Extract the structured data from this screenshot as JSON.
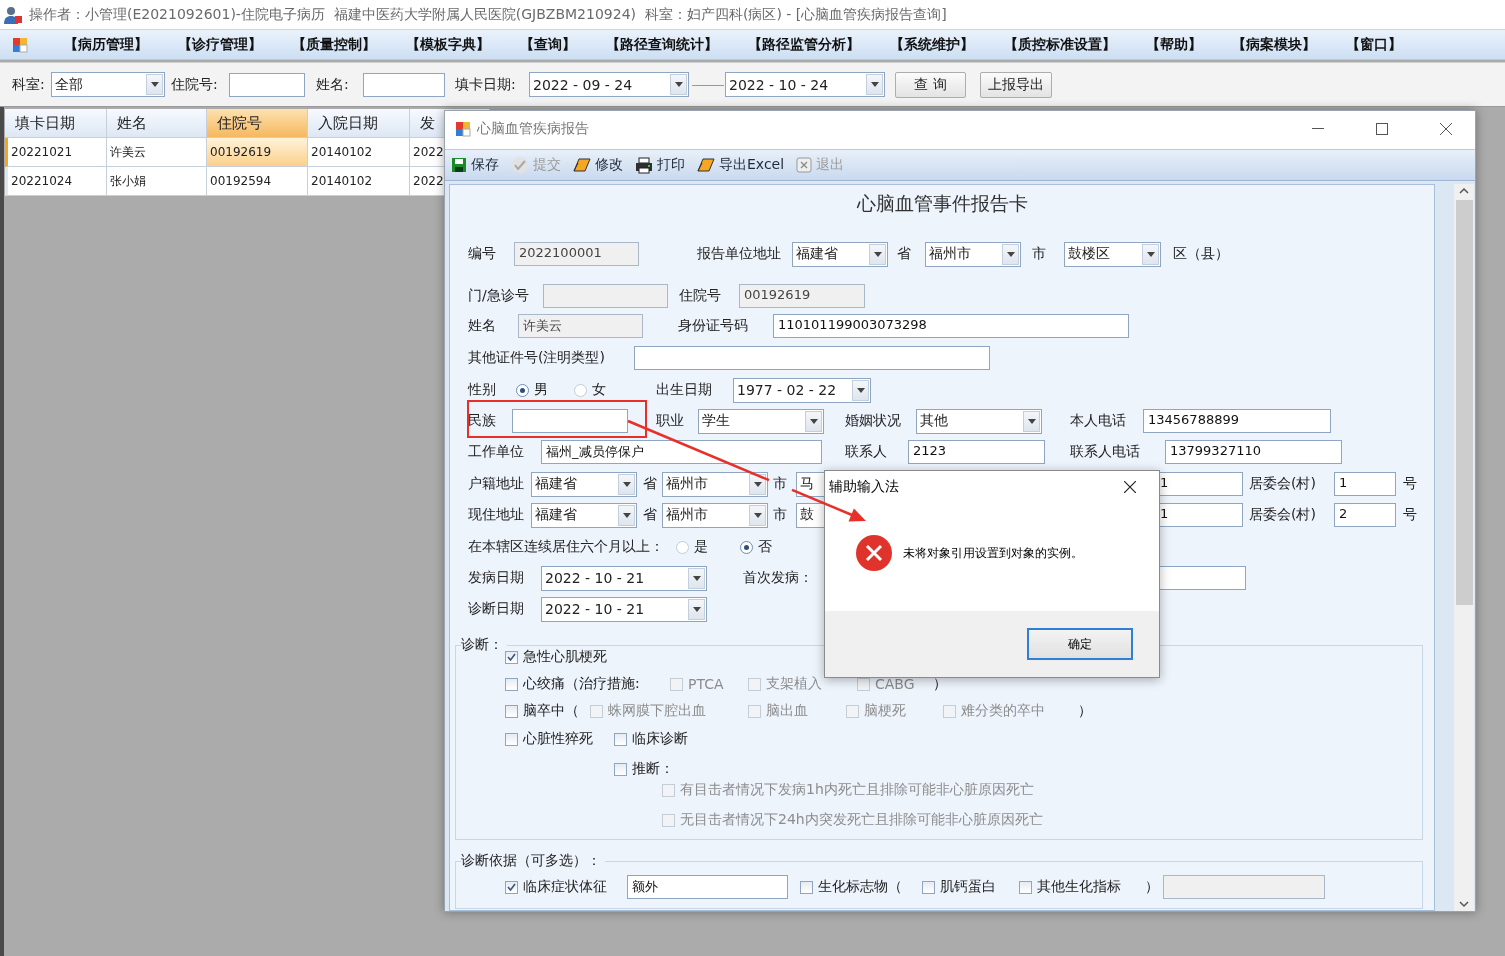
{
  "title_bar": {
    "text": "操作者：小管理(E2021092601)-住院电子病历  福建中医药大学附属人民医院(GJBZBM210924)  科室：妇产四科(病区) - [心脑血管疾病报告查询]"
  },
  "menu": [
    "【病历管理】",
    "【诊疗管理】",
    "【质量控制】",
    "【模板字典】",
    "【查询】",
    "【路径查询统计】",
    "【路径监管分析】",
    "【系统维护】",
    "【质控标准设置】",
    "【帮助】",
    "【病案模块】",
    "【窗口】"
  ],
  "filter": [
    {
      "kind": "label",
      "text": "科室:"
    },
    {
      "kind": "combo",
      "value": "全部"
    },
    {
      "kind": "label",
      "text": "住院号:"
    },
    {
      "kind": "field",
      "readonly": false
    },
    {
      "kind": "label",
      "text": "姓名:"
    },
    {
      "kind": "field",
      "readonly": false
    },
    {
      "kind": "label",
      "text": "填卡日期:"
    },
    {
      "kind": "date",
      "value": "2022 - 09 - 24"
    },
    {
      "kind": "date",
      "value": "2022 - 10 - 24"
    },
    {
      "kind": "button",
      "text": "查 询"
    },
    {
      "kind": "button",
      "text": "上报导出"
    }
  ],
  "table": {
    "columns": [
      {
        "label": "填卡日期",
        "selected": false
      },
      {
        "label": "姓名",
        "selected": false
      },
      {
        "label": "住院号",
        "selected": true
      },
      {
        "label": "入院日期",
        "selected": false
      },
      {
        "label": "发",
        "selected": false
      }
    ],
    "rows": [
      {
        "selected": true,
        "cells": [
          "20221021",
          "许美云",
          "00192619",
          "20140102",
          "2022"
        ]
      },
      {
        "selected": false,
        "cells": [
          "20221024",
          "张小娟",
          "00192594",
          "20140102",
          "2022"
        ]
      }
    ]
  },
  "report_window": {
    "title": "心脑血管疾病报告",
    "toolbar": [
      {
        "label": "保存",
        "disabled": false
      },
      {
        "label": "提交",
        "disabled": true
      },
      {
        "label": "修改",
        "disabled": false
      },
      {
        "label": "打印",
        "disabled": false
      },
      {
        "label": "导出Excel",
        "disabled": false
      },
      {
        "label": "退出",
        "disabled": true
      }
    ],
    "heading": "心脑血管事件报告卡",
    "form": [
      {
        "items": [
          {
            "kind": "label",
            "text": "编号"
          },
          {
            "kind": "field",
            "value": "2022100001",
            "readonly": true
          },
          {
            "kind": "label",
            "text": "报告单位地址"
          },
          {
            "kind": "combo",
            "value": "福建省"
          },
          {
            "kind": "label",
            "text": "省"
          },
          {
            "kind": "combo",
            "value": "福州市"
          },
          {
            "kind": "label",
            "text": "市"
          },
          {
            "kind": "combo",
            "value": "鼓楼区"
          },
          {
            "kind": "label",
            "text": "区（县）"
          }
        ]
      },
      {
        "items": [
          {
            "kind": "label",
            "text": "门/急诊号"
          },
          {
            "kind": "field",
            "readonly": true
          },
          {
            "kind": "label",
            "text": "住院号"
          },
          {
            "kind": "field",
            "value": "00192619",
            "readonly": true
          }
        ]
      },
      {
        "items": [
          {
            "kind": "label",
            "text": "姓名"
          },
          {
            "kind": "field",
            "value": "许美云",
            "readonly": true
          },
          {
            "kind": "label",
            "text": "身份证号码"
          },
          {
            "kind": "field",
            "value": "110101199003073298",
            "readonly": false
          }
        ]
      },
      {
        "items": [
          {
            "kind": "label",
            "text": "其他证件号(注明类型)"
          },
          {
            "kind": "field",
            "readonly": false
          }
        ]
      },
      {
        "items": [
          {
            "kind": "label",
            "text": "性别"
          },
          {
            "kind": "radio",
            "text": "男",
            "selected": true
          },
          {
            "kind": "radio",
            "text": "女",
            "selected": false
          },
          {
            "kind": "label",
            "text": "出生日期"
          },
          {
            "kind": "date",
            "value": "1977 - 02 - 22"
          }
        ]
      },
      {
        "items": [
          {
            "kind": "label",
            "text": "民族"
          },
          {
            "kind": "field",
            "readonly": false
          },
          {
            "kind": "label",
            "text": "职业"
          },
          {
            "kind": "combo",
            "value": "学生"
          },
          {
            "kind": "label",
            "text": "婚姻状况"
          },
          {
            "kind": "combo",
            "value": "其他"
          },
          {
            "kind": "label",
            "text": "本人电话"
          },
          {
            "kind": "field",
            "value": "13456788899",
            "readonly": false
          }
        ]
      },
      {
        "items": [
          {
            "kind": "label",
            "text": "工作单位"
          },
          {
            "kind": "field",
            "value": "福州_减员停保户",
            "readonly": false
          },
          {
            "kind": "label",
            "text": "联系人"
          },
          {
            "kind": "field",
            "value": "2123",
            "readonly": false
          },
          {
            "kind": "label",
            "text": "联系人电话"
          },
          {
            "kind": "field",
            "value": "13799327110",
            "readonly": false
          }
        ]
      },
      {
        "items": [
          {
            "kind": "label",
            "text": "户籍地址"
          },
          {
            "kind": "combo",
            "value": "福建省"
          },
          {
            "kind": "label",
            "text": "省"
          },
          {
            "kind": "combo",
            "value": "福州市"
          },
          {
            "kind": "label",
            "text": "市"
          },
          {
            "kind": "combo",
            "value": "马"
          },
          {
            "kind": "field",
            "value": "1",
            "readonly": false
          },
          {
            "kind": "label",
            "text": "居委会(村)"
          },
          {
            "kind": "field",
            "value": "1",
            "readonly": false
          },
          {
            "kind": "label",
            "text": "号"
          }
        ]
      },
      {
        "items": [
          {
            "kind": "label",
            "text": "现住地址"
          },
          {
            "kind": "combo",
            "value": "福建省"
          },
          {
            "kind": "label",
            "text": "省"
          },
          {
            "kind": "combo",
            "value": "福州市"
          },
          {
            "kind": "label",
            "text": "市"
          },
          {
            "kind": "combo",
            "value": "鼓"
          },
          {
            "kind": "field",
            "value": "1",
            "readonly": false
          },
          {
            "kind": "label",
            "text": "居委会(村)"
          },
          {
            "kind": "field",
            "value": "2",
            "readonly": false
          },
          {
            "kind": "label",
            "text": "号"
          }
        ]
      },
      {
        "items": [
          {
            "kind": "label",
            "text": "在本辖区连续居住六个月以上："
          },
          {
            "kind": "radio",
            "text": "是",
            "selected": false
          },
          {
            "kind": "radio",
            "text": "否",
            "selected": true
          }
        ]
      },
      {
        "items": [
          {
            "kind": "label",
            "text": "发病日期"
          },
          {
            "kind": "date",
            "value": "2022 - 10 - 21"
          },
          {
            "kind": "label",
            "text": "首次发病："
          },
          {
            "kind": "field",
            "readonly": false
          }
        ]
      },
      {
        "items": [
          {
            "kind": "label",
            "text": "诊断日期"
          },
          {
            "kind": "date",
            "value": "2022 - 10 - 21"
          }
        ]
      }
    ],
    "diagnosis": {
      "title": "诊断：",
      "rows": [
        {
          "items": [
            {
              "kind": "check",
              "text": "急性心肌梗死",
              "checked": true,
              "disabled": false
            }
          ]
        },
        {
          "items": [
            {
              "kind": "check",
              "text": "心绞痛（治疗措施:",
              "checked": false,
              "disabled": false
            },
            {
              "kind": "check",
              "text": "PTCA",
              "checked": false,
              "disabled": true
            },
            {
              "kind": "check",
              "text": "支架植入",
              "checked": false,
              "disabled": true
            },
            {
              "kind": "check",
              "text": "CABG",
              "checked": false,
              "disabled": true
            },
            {
              "kind": "text",
              "text": "）"
            }
          ]
        },
        {
          "items": [
            {
              "kind": "check",
              "text": "脑卒中（",
              "checked": false,
              "disabled": false
            },
            {
              "kind": "check",
              "text": "蛛网膜下腔出血",
              "checked": false,
              "disabled": true
            },
            {
              "kind": "check",
              "text": "脑出血",
              "checked": false,
              "disabled": true
            },
            {
              "kind": "check",
              "text": "脑梗死",
              "checked": false,
              "disabled": true
            },
            {
              "kind": "check",
              "text": "难分类的卒中",
              "checked": false,
              "disabled": true
            },
            {
              "kind": "text",
              "text": "）"
            }
          ]
        },
        {
          "items": [
            {
              "kind": "check",
              "text": "心脏性猝死",
              "checked": false,
              "disabled": false
            },
            {
              "kind": "check",
              "text": "临床诊断",
              "checked": false,
              "disabled": false
            }
          ]
        },
        {
          "items": [
            {
              "kind": "check",
              "text": "推断：",
              "checked": false,
              "disabled": false
            }
          ],
          "children": [
            {
              "items": [
                {
                  "kind": "check",
                  "text": "有目击者情况下发病1h内死亡且排除可能非心脏原因死亡",
                  "checked": false,
                  "disabled": true
                }
              ]
            },
            {
              "items": [
                {
                  "kind": "check",
                  "text": "无目击者情况下24h内突发死亡且排除可能非心脏原因死亡",
                  "checked": false,
                  "disabled": true
                }
              ]
            }
          ]
        }
      ]
    },
    "basis": {
      "title": "诊断依据（可多选）：",
      "rows": [
        {
          "items": [
            {
              "kind": "check",
              "text": "临床症状体征",
              "checked": true,
              "disabled": false
            },
            {
              "kind": "field",
              "value": "额外",
              "readonly": false
            },
            {
              "kind": "check",
              "text": "生化标志物（",
              "checked": false,
              "disabled": false
            },
            {
              "kind": "check",
              "text": "肌钙蛋白",
              "checked": false,
              "disabled": false
            },
            {
              "kind": "check",
              "text": "其他生化指标",
              "checked": false,
              "disabled": false
            },
            {
              "kind": "text",
              "text": "）"
            },
            {
              "kind": "field",
              "readonly": true
            }
          ]
        }
      ]
    }
  },
  "dialog": {
    "title": "辅助输入法",
    "message": "未将对象引用设置到对象的实例。",
    "button": "确定"
  },
  "annotation": {
    "highlight_box": true,
    "arrow": true
  }
}
